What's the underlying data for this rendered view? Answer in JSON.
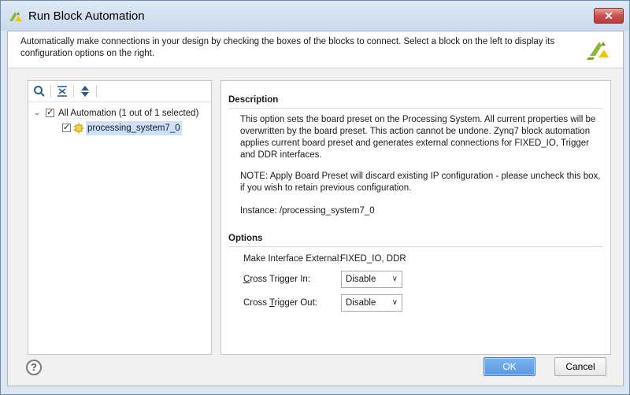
{
  "window": {
    "title": "Run Block Automation",
    "close_glyph": "✕"
  },
  "header": {
    "description_line1": "Automatically make connections in your design by checking the boxes of the blocks to connect. Select a block on the left to display its",
    "description_line2": "configuration options on the right."
  },
  "tree": {
    "toolbar_icons": [
      "search-icon",
      "collapse-all-icon",
      "expand-all-icon"
    ],
    "root": {
      "label": "All Automation (1 out of 1 selected)",
      "checked": true,
      "expanded": true
    },
    "child": {
      "label": "processing_system7_0",
      "checked": true,
      "selected": true
    }
  },
  "description": {
    "title": "Description",
    "paragraph1_lines": [
      "This option sets the board preset on the Processing System. All current properties will be",
      "overwritten by the board preset. This action cannot be undone. Zynq7 block automation",
      "applies current board preset and generates external connections for FIXED_IO, Trigger",
      "and DDR interfaces."
    ],
    "paragraph2_lines": [
      "NOTE: Apply Board Preset will discard existing IP configuration - please uncheck this box,",
      "if you wish to retain previous configuration."
    ],
    "instance": "Instance: /processing_system7_0"
  },
  "options": {
    "title": "Options",
    "make_interface_label": "Make Interface External:",
    "make_interface_value": "FIXED_IO, DDR",
    "cross_trigger_in_label_pre": "",
    "cross_trigger_in_label_u": "C",
    "cross_trigger_in_label_post": "ross Trigger In:",
    "cross_trigger_in_value": "Disable",
    "cross_trigger_out_label_pre": "Cross ",
    "cross_trigger_out_label_u": "T",
    "cross_trigger_out_label_post": "rigger Out:",
    "cross_trigger_out_value": "Disable"
  },
  "footer": {
    "help_glyph": "?",
    "ok_label": "OK",
    "cancel_label": "Cancel"
  },
  "colors": {
    "accent": "#5a98e0",
    "selection": "#cce0f7",
    "logo_green": "#8bb82d"
  }
}
